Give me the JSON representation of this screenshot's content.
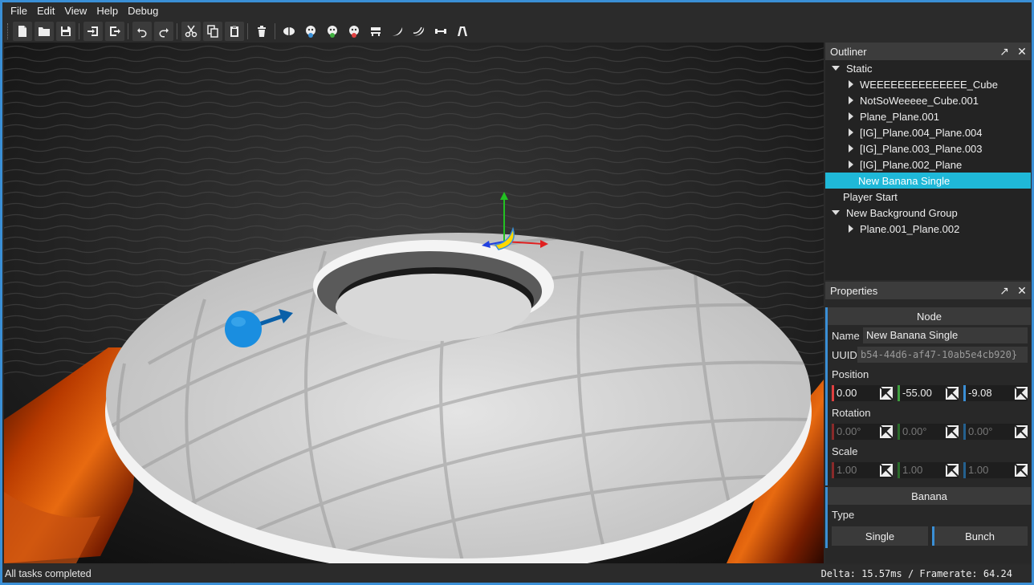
{
  "menu": [
    "File",
    "Edit",
    "View",
    "Help",
    "Debug"
  ],
  "outliner": {
    "title": "Outliner",
    "items": [
      {
        "label": "Static",
        "depth": 0,
        "arrow": "down"
      },
      {
        "label": "WEEEEEEEEEEEEEE_Cube",
        "depth": 1,
        "arrow": "right"
      },
      {
        "label": "NotSoWeeeee_Cube.001",
        "depth": 1,
        "arrow": "right"
      },
      {
        "label": "Plane_Plane.001",
        "depth": 1,
        "arrow": "right"
      },
      {
        "label": "[IG]_Plane.004_Plane.004",
        "depth": 1,
        "arrow": "right"
      },
      {
        "label": "[IG]_Plane.003_Plane.003",
        "depth": 1,
        "arrow": "right"
      },
      {
        "label": "[IG]_Plane.002_Plane",
        "depth": 1,
        "arrow": "right"
      },
      {
        "label": "New Banana Single",
        "depth": 1,
        "arrow": "none",
        "selected": true
      },
      {
        "label": "Player Start",
        "depth": 0,
        "arrow": "none"
      },
      {
        "label": "New Background Group",
        "depth": 0,
        "arrow": "down"
      },
      {
        "label": "Plane.001_Plane.002",
        "depth": 1,
        "arrow": "right"
      }
    ]
  },
  "properties": {
    "title": "Properties",
    "node_section": "Node",
    "name_label": "Name",
    "name_value": "New Banana Single",
    "uuid_label": "UUID",
    "uuid_value": "b54-44d6-af47-10ab5e4cb920}",
    "position_label": "Position",
    "position": [
      "0.00",
      "-55.00",
      "-9.08"
    ],
    "rotation_label": "Rotation",
    "rotation": [
      "0.00°",
      "0.00°",
      "0.00°"
    ],
    "scale_label": "Scale",
    "scale": [
      "1.00",
      "1.00",
      "1.00"
    ],
    "banana_section": "Banana",
    "type_label": "Type",
    "type_options": [
      "Single",
      "Bunch"
    ]
  },
  "status": {
    "left": "All tasks completed",
    "right": "Delta: 15.57ms / Framerate: 64.24"
  },
  "colors": {
    "accent": "#3a8fd6",
    "selection": "#1fb8d8",
    "axis_x": "#e04040",
    "axis_y": "#40a040",
    "axis_z": "#3a8fd6"
  }
}
